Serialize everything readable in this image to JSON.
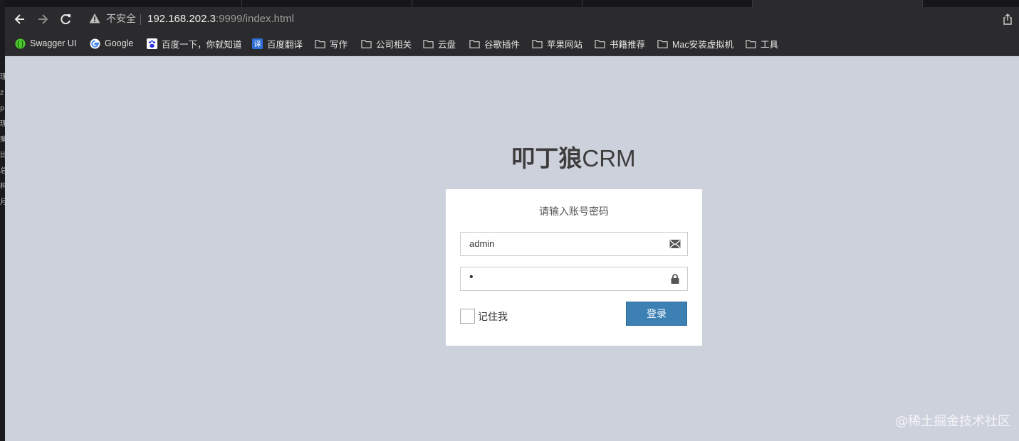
{
  "browser": {
    "security_label": "不安全",
    "url_host": "192.168.202.3",
    "url_path": ":9999/index.html",
    "bookmarks": [
      {
        "label": "Swagger UI",
        "icon": "swagger-icon"
      },
      {
        "label": "Google",
        "icon": "google-icon"
      },
      {
        "label": "百度一下，你就知道",
        "icon": "baidu-icon"
      },
      {
        "label": "百度翻译",
        "icon": "translate-icon"
      },
      {
        "label": "写作",
        "icon": "folder-icon"
      },
      {
        "label": "公司相关",
        "icon": "folder-icon"
      },
      {
        "label": "云盘",
        "icon": "folder-icon"
      },
      {
        "label": "谷歌插件",
        "icon": "folder-icon"
      },
      {
        "label": "苹果网站",
        "icon": "folder-icon"
      },
      {
        "label": "书籍推荐",
        "icon": "folder-icon"
      },
      {
        "label": "Mac安装虚拟机",
        "icon": "folder-icon"
      },
      {
        "label": "工具",
        "icon": "folder-icon"
      }
    ]
  },
  "page": {
    "title_cn": "叩丁狼",
    "title_en": "CRM",
    "prompt": "请输入账号密码",
    "username_value": "admin",
    "password_mask": "•",
    "remember_label": "记住我",
    "login_label": "登录"
  },
  "overlay": {
    "watermark": "@稀土掘金技术社区"
  },
  "colors": {
    "background": "#cdd1dc",
    "button": "#3c80b4",
    "card": "#ffffff"
  }
}
